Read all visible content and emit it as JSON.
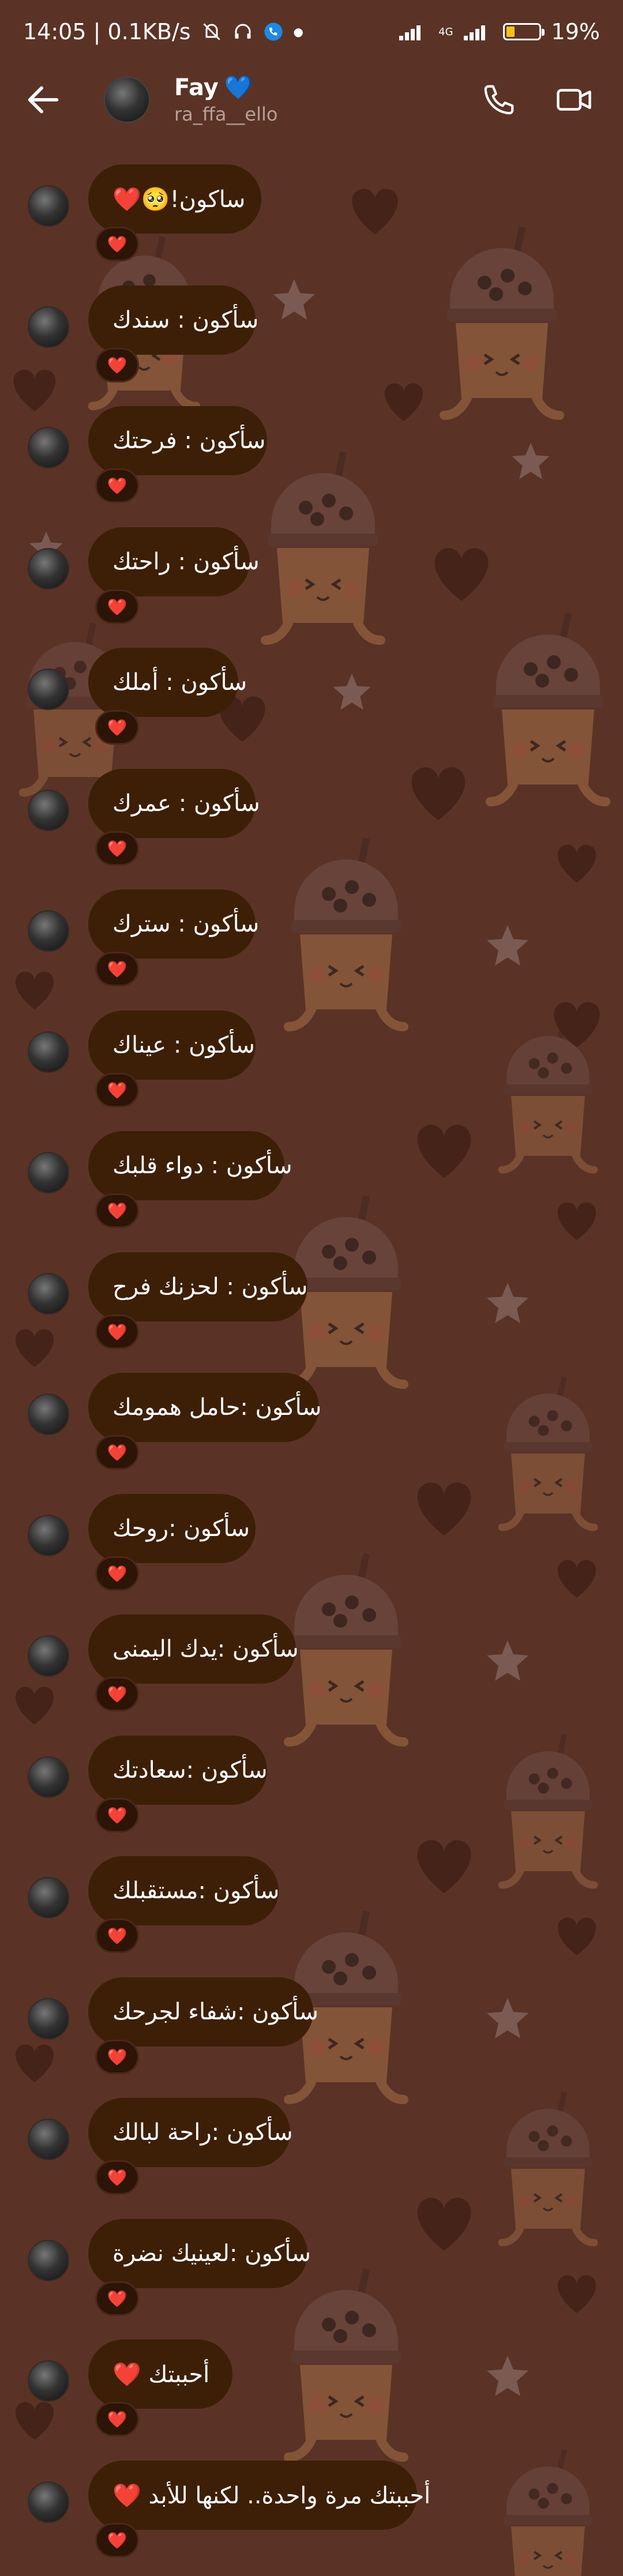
{
  "status_bar": {
    "time_speed": "14:05 | 0.1KB/s",
    "network": "4G",
    "battery": "19%",
    "battery_level": 0.19
  },
  "header": {
    "name": "Fay",
    "name_emoji": "💙",
    "username": "ra_ffa__ello"
  },
  "colors": {
    "background": "#5a3326",
    "bubble": "#3d1f08",
    "heart": "#e8233a"
  },
  "reaction_emoji": "❤️",
  "messages": [
    {
      "text": "ساكون!🥺❤️",
      "reaction": "❤️"
    },
    {
      "text": "سأكون : سندك",
      "reaction": "❤️"
    },
    {
      "text": "سأكون : فرحتك",
      "reaction": "❤️"
    },
    {
      "text": "سأكون : راحتك",
      "reaction": "❤️"
    },
    {
      "text": "سأكون : أملك",
      "reaction": "❤️"
    },
    {
      "text": "سأكون : عمرك",
      "reaction": "❤️"
    },
    {
      "text": "سأكون : سترك",
      "reaction": "❤️"
    },
    {
      "text": "سأكون : عيناك",
      "reaction": "❤️"
    },
    {
      "text": "سأكون : دواء قلبك",
      "reaction": "❤️"
    },
    {
      "text": "سأكون : لحزنك فرح",
      "reaction": "❤️"
    },
    {
      "text": "سأكون :حامل همومك",
      "reaction": "❤️"
    },
    {
      "text": "سأكون :روحك",
      "reaction": "❤️"
    },
    {
      "text": "سأكون :يدك اليمنى",
      "reaction": "❤️"
    },
    {
      "text": "سأكون :سعادتك",
      "reaction": "❤️"
    },
    {
      "text": "سأكون :مستقبلك",
      "reaction": "❤️"
    },
    {
      "text": "سأكون :شفاء لجرحك",
      "reaction": "❤️"
    },
    {
      "text": "سأكون :راحة لبالك",
      "reaction": "❤️"
    },
    {
      "text": "سأكون :لعينيك نضرة",
      "reaction": "❤️"
    },
    {
      "text": "أحببتك ❤️",
      "reaction": "❤️"
    },
    {
      "text": "أحببتك مرة واحدة.. لكنها للأبد ❤️",
      "reaction": "❤️"
    }
  ]
}
